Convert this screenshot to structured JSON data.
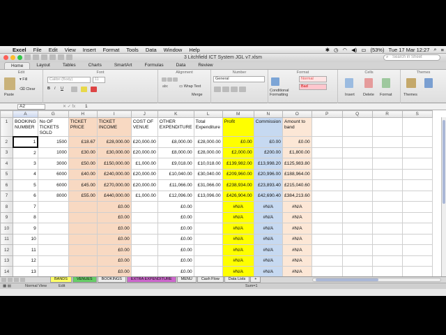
{
  "menubar": {
    "app": "Excel",
    "items": [
      "File",
      "Edit",
      "View",
      "Insert",
      "Format",
      "Tools",
      "Data",
      "Window",
      "Help"
    ],
    "battery": "(53%)",
    "datetime": "Tue 17 Mar  12:27"
  },
  "window": {
    "title": "3 Litchfield ICT System JGL v7.xlsm",
    "search_placeholder": "Search in Sheet"
  },
  "ribbon": {
    "tabs": [
      "Home",
      "Layout",
      "Tables",
      "Charts",
      "SmartArt",
      "Formulas",
      "Data",
      "Review"
    ],
    "active_tab": "Home",
    "groups": {
      "edit": "Edit",
      "font": "Font",
      "alignment": "Alignment",
      "number": "Number",
      "format": "Format",
      "cells": "Cells",
      "themes": "Themes"
    },
    "paste": "Paste",
    "fill": "Fill",
    "clear": "Clear",
    "font_name": "Calibri (Body)",
    "font_size": "11",
    "wrap_text": "Wrap Text",
    "merge": "Merge",
    "number_format": "General",
    "conditional_formatting": "Conditional Formatting",
    "style_normal": "Normal",
    "style_bad": "Bad",
    "insert": "Insert",
    "delete": "Delete",
    "format": "Format",
    "themes": "Themes",
    "abc": "abc"
  },
  "formula_bar": {
    "cell": "A2",
    "value": "1"
  },
  "columns": [
    "A",
    "G",
    "H",
    "I",
    "J",
    "K",
    "L",
    "M",
    "N",
    "O",
    "P",
    "Q",
    "R",
    "S"
  ],
  "header_row": [
    "BOOKING NUMBER",
    "No OF TICKETS SOLD",
    "TICKET PRICE",
    "TICKET INCOME",
    "COST OF VENUE",
    "OTHER EXPENDITURE",
    "Total Expenditure",
    "Profit",
    "Commission",
    "Amount to band",
    "",
    "",
    "",
    ""
  ],
  "rows": [
    {
      "n": "2",
      "cells": [
        "1",
        "1500",
        "£18.67",
        "£28,000.00",
        "£20,000.00",
        "£8,000.00",
        "£28,000.00",
        "£0.00",
        "£0.00",
        "£0.00"
      ]
    },
    {
      "n": "3",
      "cells": [
        "2",
        "1000",
        "£30.00",
        "£30,000.00",
        "£20,000.00",
        "£8,000.00",
        "£28,000.00",
        "£2,000.00",
        "£200.00",
        "£1,800.00"
      ]
    },
    {
      "n": "4",
      "cells": [
        "3",
        "3000",
        "£50.00",
        "£150,000.00",
        "£1,000.00",
        "£9,018.00",
        "£10,018.00",
        "£139,982.00",
        "£13,998.20",
        "£125,983.80"
      ]
    },
    {
      "n": "5",
      "cells": [
        "4",
        "6000",
        "£40.00",
        "£240,000.00",
        "£20,000.00",
        "£10,040.00",
        "£30,040.00",
        "£209,960.00",
        "£20,996.00",
        "£188,964.00"
      ]
    },
    {
      "n": "6",
      "cells": [
        "5",
        "6000",
        "£45.00",
        "£270,000.00",
        "£20,000.00",
        "£11,066.00",
        "£31,066.00",
        "£238,934.00",
        "£23,893.40",
        "£215,040.60"
      ]
    },
    {
      "n": "7",
      "cells": [
        "6",
        "8000",
        "£55.00",
        "£440,000.00",
        "£1,000.00",
        "£12,096.00",
        "£13,096.00",
        "£426,904.00",
        "£42,690.40",
        "£384,213.60"
      ]
    },
    {
      "n": "8",
      "cells": [
        "7",
        "",
        "",
        "£0.00",
        "",
        "£0.00",
        "",
        "#N/A",
        "#N/A",
        "#N/A"
      ]
    },
    {
      "n": "9",
      "cells": [
        "8",
        "",
        "",
        "£0.00",
        "",
        "£0.00",
        "",
        "#N/A",
        "#N/A",
        "#N/A"
      ]
    },
    {
      "n": "10",
      "cells": [
        "9",
        "",
        "",
        "£0.00",
        "",
        "£0.00",
        "",
        "#N/A",
        "#N/A",
        "#N/A"
      ]
    },
    {
      "n": "11",
      "cells": [
        "10",
        "",
        "",
        "£0.00",
        "",
        "£0.00",
        "",
        "#N/A",
        "#N/A",
        "#N/A"
      ]
    },
    {
      "n": "12",
      "cells": [
        "11",
        "",
        "",
        "£0.00",
        "",
        "£0.00",
        "",
        "#N/A",
        "#N/A",
        "#N/A"
      ]
    },
    {
      "n": "13",
      "cells": [
        "12",
        "",
        "",
        "£0.00",
        "",
        "£0.00",
        "",
        "#N/A",
        "#N/A",
        "#N/A"
      ]
    },
    {
      "n": "14",
      "cells": [
        "13",
        "",
        "",
        "£0.00",
        "",
        "£0.00",
        "",
        "#N/A",
        "#N/A",
        "#N/A"
      ]
    },
    {
      "n": "15",
      "cells": [
        "14",
        "",
        "",
        "£0.00",
        "",
        "£0.00",
        "",
        "#N/A",
        "#N/A",
        "#N/A"
      ]
    },
    {
      "n": "16",
      "cells": [
        "15",
        "",
        "",
        "£0.00",
        "",
        "£0.00",
        "",
        "#N/A",
        "#N/A",
        "#N/A"
      ]
    }
  ],
  "sheet_tabs": [
    {
      "label": "BANDS",
      "color": "#ffff66"
    },
    {
      "label": "VENUES",
      "color": "#66cc66"
    },
    {
      "label": "BOOKINGS",
      "color": "#ececec"
    },
    {
      "label": "EXTRA EXPENDITURE",
      "color": "#cc66cc"
    },
    {
      "label": "MENU",
      "color": "#ececec"
    },
    {
      "label": "Cash Flow",
      "color": "#ececec"
    },
    {
      "label": "Data Lists",
      "color": "#ececec"
    }
  ],
  "status": {
    "view": "Normal View",
    "mode": "Edit",
    "sum": "Sum=1"
  },
  "colors": {
    "orange": "#f8d9c2",
    "yellow": "#ffff00",
    "blue": "#c6d9f1"
  }
}
